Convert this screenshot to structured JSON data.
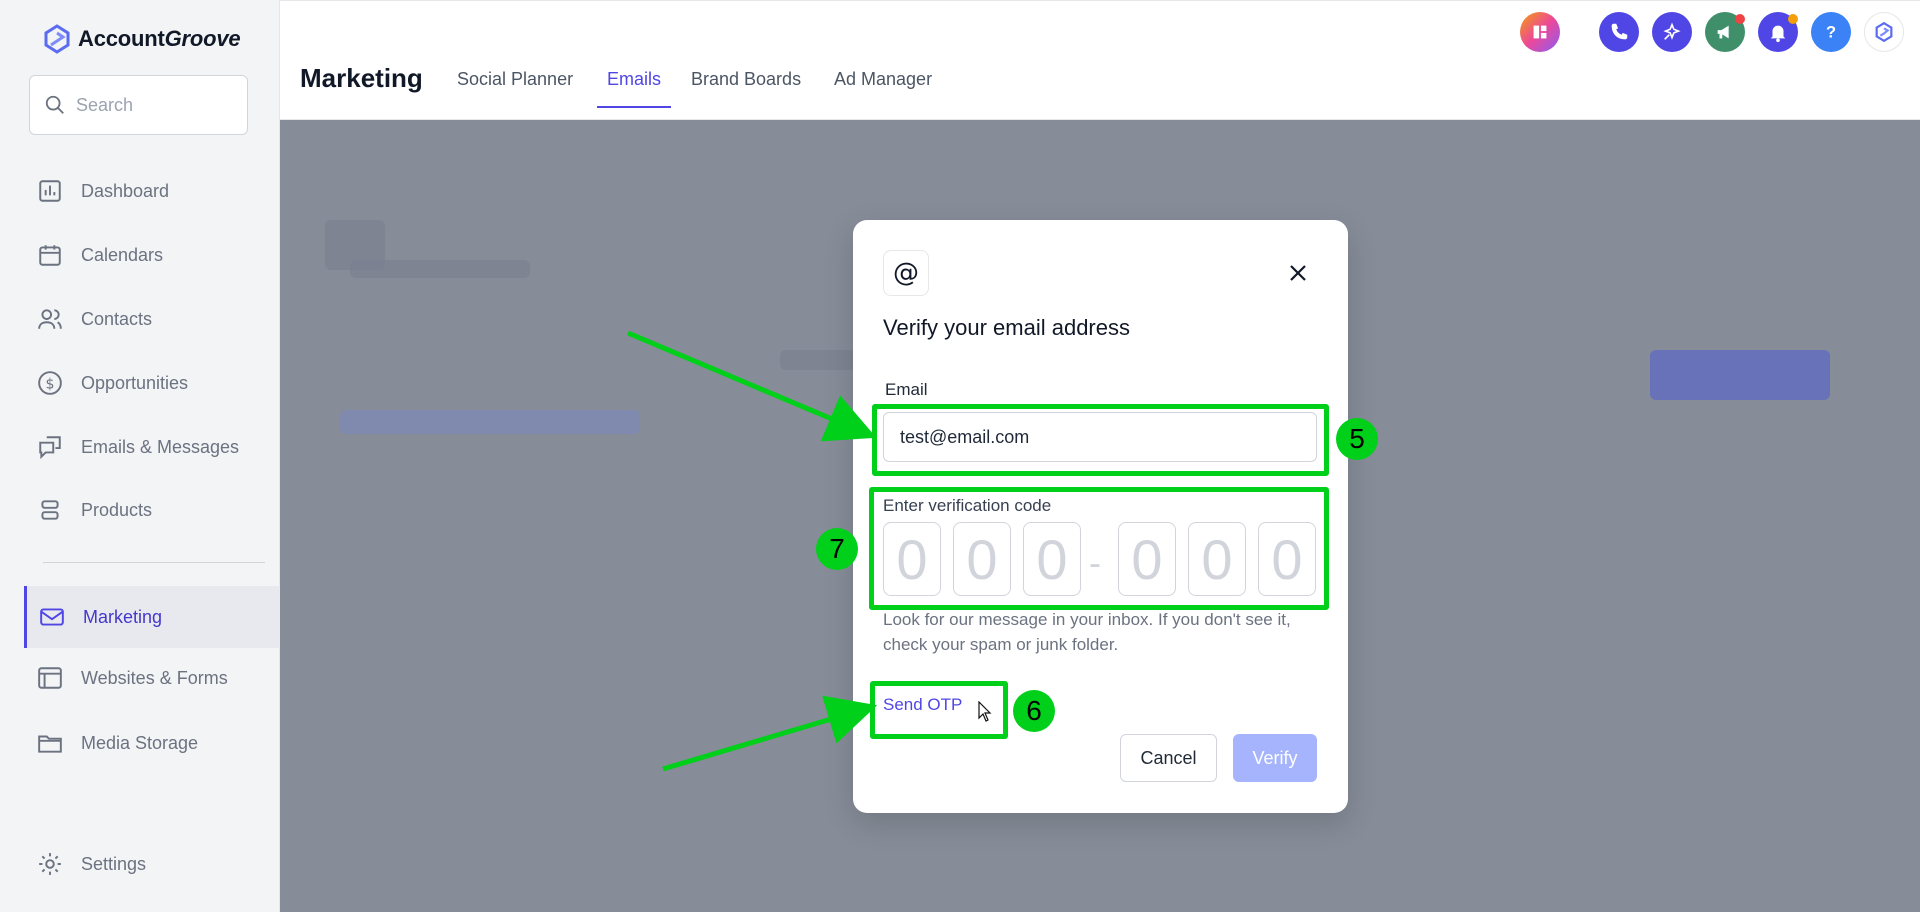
{
  "brand": {
    "name_plain": "Account",
    "name_italic": "Groove"
  },
  "search": {
    "placeholder": "Search"
  },
  "sidebar": {
    "items": [
      {
        "label": "Dashboard",
        "icon": "chart-icon"
      },
      {
        "label": "Calendars",
        "icon": "calendar-icon"
      },
      {
        "label": "Contacts",
        "icon": "users-icon"
      },
      {
        "label": "Opportunities",
        "icon": "dollar-icon"
      },
      {
        "label": "Emails & Messages",
        "icon": "messages-icon"
      },
      {
        "label": "Products",
        "icon": "box-icon"
      },
      {
        "label": "Marketing",
        "icon": "mail-icon",
        "active": true
      },
      {
        "label": "Websites & Forms",
        "icon": "browser-icon"
      },
      {
        "label": "Media Storage",
        "icon": "folder-icon"
      },
      {
        "label": "Settings",
        "icon": "gear-icon"
      }
    ]
  },
  "header": {
    "title": "Marketing",
    "tabs": [
      "Social Planner",
      "Emails",
      "Brand Boards",
      "Ad Manager"
    ],
    "active_tab": "Emails",
    "icons": [
      "apps-icon",
      "phone-icon",
      "magic-icon",
      "megaphone-icon",
      "bell-icon",
      "help-icon",
      "profile-logo-icon"
    ]
  },
  "modal": {
    "icon_glyph": "@",
    "title": "Verify your email address",
    "email_label": "Email",
    "email_value": "test@email.com",
    "code_label": "Enter verification code",
    "otp_digits": [
      "0",
      "0",
      "0",
      "0",
      "0",
      "0"
    ],
    "otp_separator": "-",
    "hint": "Look for our message in your inbox. If you don't see it, check your spam or junk folder.",
    "send_otp": "Send OTP",
    "cancel": "Cancel",
    "verify": "Verify"
  },
  "annotations": {
    "badge_email": "5",
    "badge_send": "6",
    "badge_code": "7"
  },
  "colors": {
    "accent": "#4f46e5",
    "highlight": "#00d01a",
    "overlay": "#868c98"
  }
}
